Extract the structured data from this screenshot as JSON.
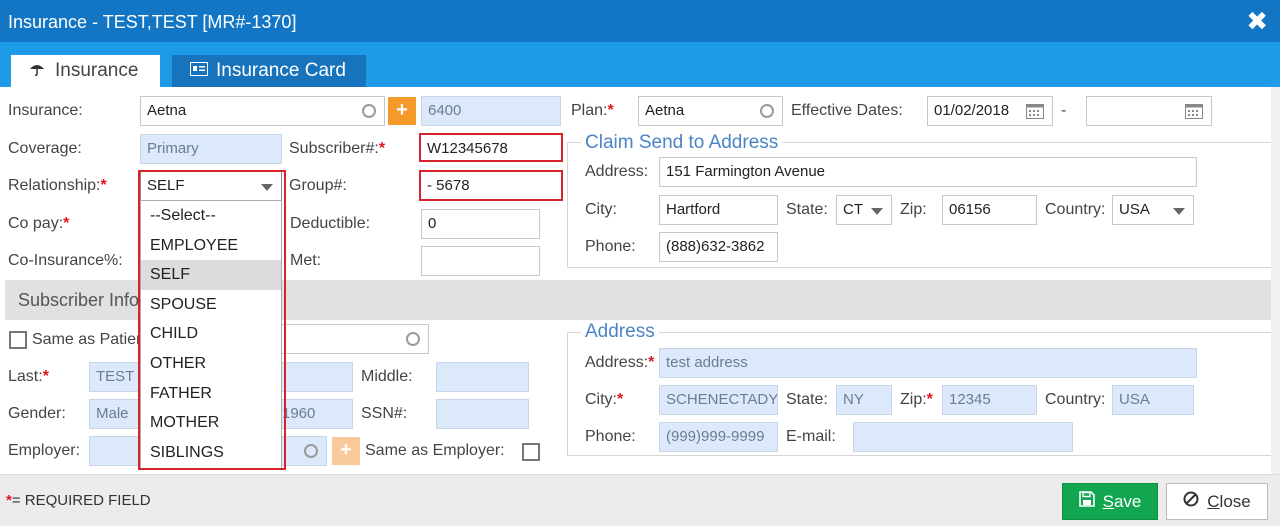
{
  "window": {
    "title": "Insurance - TEST,TEST [MR#-1370]",
    "close_glyph": "✖"
  },
  "tabs": [
    {
      "label": "Insurance",
      "icon": "umbrella-icon",
      "active": true
    },
    {
      "label": "Insurance Card",
      "icon": "id-card-icon",
      "active": false
    }
  ],
  "form": {
    "insurance_label": "Insurance:",
    "insurance_value": "Aetna",
    "insurance_code": "6400",
    "plan_label": "Plan:",
    "plan_value": "Aetna",
    "effective_dates_label": "Effective Dates:",
    "effective_from": "01/02/2018",
    "effective_sep": "-",
    "effective_to": "",
    "coverage_label": "Coverage:",
    "coverage_value": "Primary",
    "subscriber_num_label": "Subscriber#:",
    "subscriber_num_value": "W12345678",
    "relationship_label": "Relationship:",
    "relationship_value": "SELF",
    "group_label": "Group#:",
    "group_value": "- 5678",
    "copay_label": "Co pay:",
    "deductible_label": "Deductible:",
    "deductible_value": "0",
    "coinsurance_label": "Co-Insurance%:",
    "met_label": "Met:",
    "met_value": "",
    "required_mark": "*"
  },
  "relationship_options": [
    "--Select--",
    "EMPLOYEE",
    "SELF",
    "SPOUSE",
    "CHILD",
    "OTHER",
    "FATHER",
    "MOTHER",
    "SIBLINGS"
  ],
  "relationship_selected": "SELF",
  "claim_address": {
    "legend": "Claim Send to Address",
    "address_label": "Address:",
    "address_value": "151 Farmington Avenue",
    "city_label": "City:",
    "city_value": "Hartford",
    "state_label": "State:",
    "state_value": "CT",
    "zip_label": "Zip:",
    "zip_value": "06156",
    "country_label": "Country:",
    "country_value": "USA",
    "phone_label": "Phone:",
    "phone_value": "(888)632-3862"
  },
  "subscriber": {
    "section_title": "Subscriber Info",
    "same_as_patient_label": "Same as Patient",
    "last_label": "Last:",
    "last_value": "TEST",
    "middle_label": "Middle:",
    "middle_value": "",
    "gender_label": "Gender:",
    "gender_value": "Male",
    "dob_value": "1960",
    "ssn_label": "SSN#:",
    "ssn_value": "",
    "employer_label": "Employer:",
    "same_as_employer_label": "Same as Employer:"
  },
  "subscriber_address": {
    "legend": "Address",
    "address_label": "Address:",
    "address_value": "test address",
    "city_label": "City:",
    "city_value": "SCHENECTADY",
    "state_label": "State:",
    "state_value": "NY",
    "zip_label": "Zip:",
    "zip_value": "12345",
    "country_label": "Country:",
    "country_value": "USA",
    "phone_label": "Phone:",
    "phone_value": "(999)999-9999",
    "email_label": "E-mail:",
    "email_value": ""
  },
  "footer": {
    "required_note": "= REQUIRED FIELD",
    "save_label_first": "S",
    "save_label_rest": "ave",
    "close_label_first": "C",
    "close_label_rest": "lose"
  },
  "colors": {
    "title_bar": "#1276c4",
    "tab_strip": "#1d9be7",
    "required": "#e0161e",
    "highlight_box": "#d9232a",
    "save_button": "#12a651",
    "add_button": "#f39a2b"
  }
}
